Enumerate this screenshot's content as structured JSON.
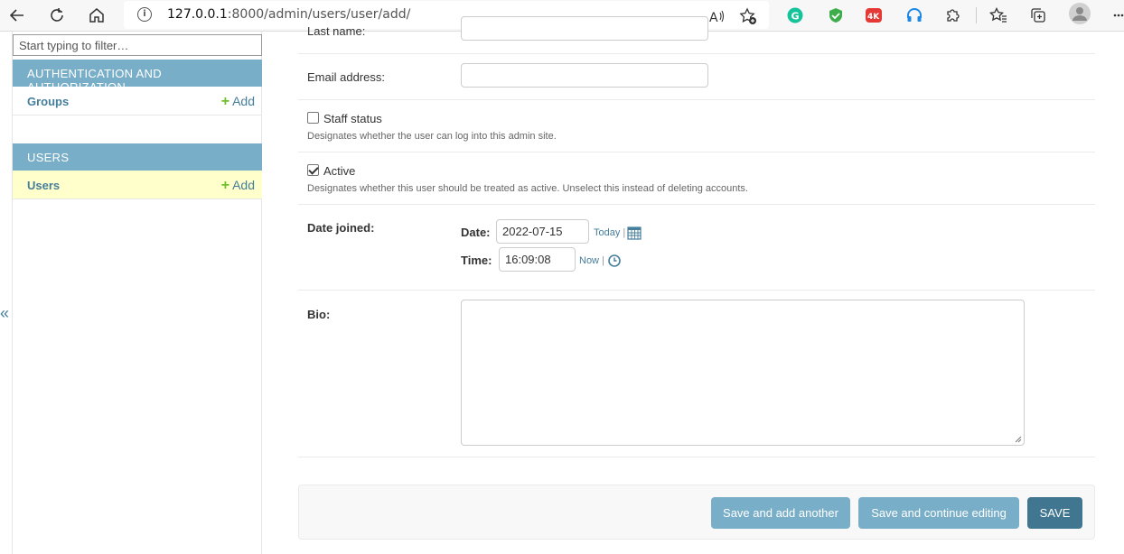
{
  "browser": {
    "url_host": "127.0.0.1",
    "url_path": ":8000/admin/users/user/add/",
    "icons": [
      "back-icon",
      "refresh-icon",
      "home-icon",
      "info-icon",
      "read-aloud-icon",
      "add-favorite-icon",
      "grammarly-icon",
      "shield-extension-icon",
      "video-4k-extension-icon",
      "headphones-extension-icon",
      "extensions-icon",
      "favorites-icon",
      "collections-icon",
      "profile-icon",
      "more-icon"
    ]
  },
  "sidebar": {
    "filter_placeholder": "Start typing to filter…",
    "collapse_label": "«",
    "modules": [
      {
        "title": "AUTHENTICATION AND AUTHORIZATION",
        "items": [
          {
            "name": "Groups",
            "add": "Add"
          }
        ]
      },
      {
        "title": "USERS",
        "items": [
          {
            "name": "Users",
            "add": "Add",
            "current": true
          }
        ]
      }
    ]
  },
  "form": {
    "last_name_label": "Last name:",
    "email_label": "Email address:",
    "staff_label": "Staff status",
    "staff_checked": false,
    "staff_help": "Designates whether the user can log into this admin site.",
    "active_label": "Active",
    "active_checked": true,
    "active_help": "Designates whether this user should be treated as active. Unselect this instead of deleting accounts.",
    "date_joined_label": "Date joined:",
    "date_label": "Date:",
    "date_value": "2022-07-15",
    "today_link": "Today",
    "time_label": "Time:",
    "time_value": "16:09:08",
    "now_link": "Now",
    "separator": "|",
    "bio_label": "Bio:"
  },
  "buttons": {
    "save_add_another": "Save and add another",
    "save_continue": "Save and continue editing",
    "save": "SAVE"
  },
  "colors": {
    "module_header": "#79aec8",
    "link": "#447e9b",
    "add_plus": "#70bf2b",
    "current_row": "#ffffcc",
    "save_button": "#417690"
  }
}
